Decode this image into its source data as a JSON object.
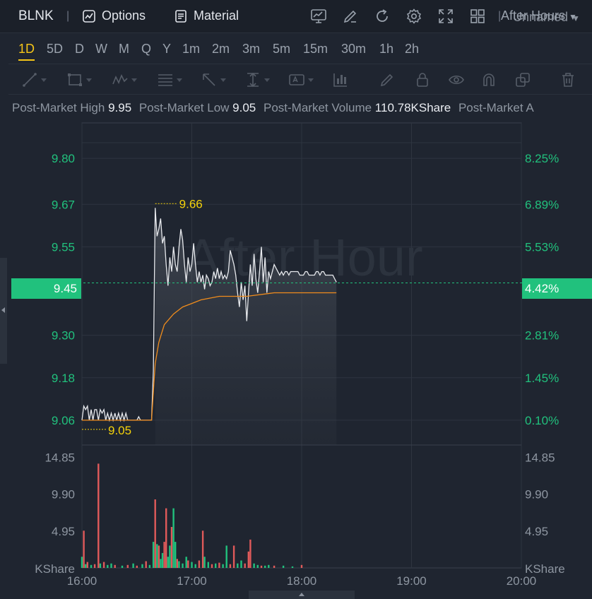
{
  "header": {
    "ticker": "BLNK",
    "separator": "|",
    "options_label": "Options",
    "material_label": "Material",
    "layout_separator": "|",
    "layout_name": "Unnamed"
  },
  "timeframes": [
    "1D",
    "5D",
    "D",
    "W",
    "M",
    "Q",
    "Y",
    "1m",
    "2m",
    "3m",
    "5m",
    "15m",
    "30m",
    "1h",
    "2h"
  ],
  "active_timeframe": "1D",
  "session_label": "After Hours",
  "stats": {
    "high_label": "Post-Market High",
    "high_value": "9.95",
    "low_label": "Post-Market Low",
    "low_value": "9.05",
    "volume_label": "Post-Market Volume",
    "volume_value": "110.78KShare",
    "truncated_label": "Post-Market A"
  },
  "colors": {
    "up": "#21c17d",
    "down": "#e05a5a",
    "price_line": "#e8eaee",
    "avg_line": "#f08c1c",
    "annotation": "#f5d20a",
    "background": "#1f2530"
  },
  "chart_data": [
    {
      "type": "line",
      "watermark": "After Hour",
      "x_ticks": [
        "16:00",
        "17:00",
        "18:00",
        "19:00",
        "20:00"
      ],
      "x_range": [
        "16:00",
        "20:00"
      ],
      "y_ticks": [
        "9.80",
        "9.67",
        "9.55",
        "9.30",
        "9.18",
        "9.06"
      ],
      "y_range": [
        8.99,
        9.9
      ],
      "y2_ticks": [
        "8.25%",
        "6.89%",
        "5.53%",
        "2.81%",
        "1.45%",
        "0.10%"
      ],
      "current_price": "9.45",
      "current_change": "4.42%",
      "annotations": [
        {
          "label": "9.66",
          "x": "16:40",
          "y": 9.66
        },
        {
          "label": "9.05",
          "x": "16:00",
          "y": 9.05
        }
      ],
      "series": [
        {
          "points": [
            [
              "16:00",
              9.06
            ],
            [
              "16:01",
              9.1
            ],
            [
              "16:02",
              9.09
            ],
            [
              "16:03",
              9.1
            ],
            [
              "16:04",
              9.06
            ],
            [
              "16:05",
              9.09
            ],
            [
              "16:06",
              9.06
            ],
            [
              "16:07",
              9.09
            ],
            [
              "16:08",
              9.09
            ],
            [
              "16:09",
              9.06
            ],
            [
              "16:10",
              9.09
            ],
            [
              "16:11",
              9.08
            ],
            [
              "16:12",
              9.09
            ],
            [
              "16:13",
              9.06
            ],
            [
              "16:14",
              9.08
            ],
            [
              "16:15",
              9.06
            ],
            [
              "16:16",
              9.08
            ],
            [
              "16:17",
              9.06
            ],
            [
              "16:18",
              9.08
            ],
            [
              "16:19",
              9.06
            ],
            [
              "16:20",
              9.08
            ],
            [
              "16:21",
              9.06
            ],
            [
              "16:22",
              9.08
            ],
            [
              "16:23",
              9.06
            ],
            [
              "16:24",
              9.08
            ],
            [
              "16:25",
              9.06
            ],
            [
              "16:26",
              9.06
            ],
            [
              "16:27",
              9.06
            ],
            [
              "16:28",
              9.06
            ],
            [
              "16:29",
              9.06
            ],
            [
              "16:30",
              9.06
            ],
            [
              "16:31",
              9.07
            ],
            [
              "16:32",
              9.06
            ],
            [
              "16:33",
              9.06
            ],
            [
              "16:34",
              9.06
            ],
            [
              "16:35",
              9.06
            ],
            [
              "16:36",
              9.06
            ],
            [
              "16:37",
              9.06
            ],
            [
              "16:38",
              9.06
            ],
            [
              "16:39",
              9.2
            ],
            [
              "16:40",
              9.66
            ],
            [
              "16:41",
              9.58
            ],
            [
              "16:42",
              9.6
            ],
            [
              "16:43",
              9.63
            ],
            [
              "16:44",
              9.56
            ],
            [
              "16:45",
              9.58
            ],
            [
              "16:46",
              9.5
            ],
            [
              "16:47",
              9.44
            ],
            [
              "16:48",
              9.52
            ],
            [
              "16:49",
              9.48
            ],
            [
              "16:50",
              9.55
            ],
            [
              "16:51",
              9.5
            ],
            [
              "16:52",
              9.48
            ],
            [
              "16:53",
              9.55
            ],
            [
              "16:54",
              9.6
            ],
            [
              "16:55",
              9.57
            ],
            [
              "16:56",
              9.5
            ],
            [
              "16:57",
              9.45
            ],
            [
              "16:58",
              9.52
            ],
            [
              "16:59",
              9.48
            ],
            [
              "17:00",
              9.5
            ],
            [
              "17:01",
              9.56
            ],
            [
              "17:02",
              9.5
            ],
            [
              "17:03",
              9.45
            ],
            [
              "17:04",
              9.48
            ],
            [
              "17:05",
              9.45
            ],
            [
              "17:06",
              9.47
            ],
            [
              "17:07",
              9.43
            ],
            [
              "17:08",
              9.47
            ],
            [
              "17:09",
              9.46
            ],
            [
              "17:10",
              9.44
            ],
            [
              "17:11",
              9.45
            ],
            [
              "17:12",
              9.48
            ],
            [
              "17:13",
              9.46
            ],
            [
              "17:14",
              9.49
            ],
            [
              "17:15",
              9.46
            ],
            [
              "17:16",
              9.48
            ],
            [
              "17:17",
              9.46
            ],
            [
              "17:18",
              9.47
            ],
            [
              "17:19",
              9.46
            ],
            [
              "17:20",
              9.48
            ],
            [
              "17:21",
              9.54
            ],
            [
              "17:22",
              9.52
            ],
            [
              "17:23",
              9.5
            ],
            [
              "17:24",
              9.47
            ],
            [
              "17:25",
              9.42
            ],
            [
              "17:26",
              9.38
            ],
            [
              "17:27",
              9.45
            ],
            [
              "17:28",
              9.4
            ],
            [
              "17:29",
              9.44
            ],
            [
              "17:30",
              9.34
            ],
            [
              "17:31",
              9.42
            ],
            [
              "17:32",
              9.5
            ],
            [
              "17:33",
              9.44
            ],
            [
              "17:34",
              9.53
            ],
            [
              "17:35",
              9.46
            ],
            [
              "17:36",
              9.42
            ],
            [
              "17:37",
              9.48
            ],
            [
              "17:38",
              9.55
            ],
            [
              "17:39",
              9.45
            ],
            [
              "17:40",
              9.52
            ],
            [
              "17:41",
              9.42
            ],
            [
              "17:42",
              9.48
            ],
            [
              "17:43",
              9.46
            ],
            [
              "17:44",
              9.48
            ],
            [
              "17:45",
              9.5
            ],
            [
              "17:46",
              9.49
            ],
            [
              "17:47",
              9.48
            ],
            [
              "17:48",
              9.47
            ],
            [
              "17:49",
              9.48
            ],
            [
              "17:50",
              9.47
            ],
            [
              "17:51",
              9.48
            ],
            [
              "17:52",
              9.48
            ],
            [
              "17:53",
              9.47
            ],
            [
              "17:54",
              9.48
            ],
            [
              "17:55",
              9.48
            ],
            [
              "17:56",
              9.48
            ],
            [
              "17:57",
              9.48
            ],
            [
              "17:58",
              9.48
            ],
            [
              "17:59",
              9.47
            ],
            [
              "18:00",
              9.47
            ],
            [
              "18:01",
              9.47
            ],
            [
              "18:02",
              9.48
            ],
            [
              "18:03",
              9.48
            ],
            [
              "18:04",
              9.47
            ],
            [
              "18:05",
              9.47
            ],
            [
              "18:06",
              9.47
            ],
            [
              "18:07",
              9.47
            ],
            [
              "18:08",
              9.48
            ],
            [
              "18:09",
              9.48
            ],
            [
              "18:10",
              9.47
            ],
            [
              "18:11",
              9.48
            ],
            [
              "18:12",
              9.48
            ],
            [
              "18:13",
              9.47
            ],
            [
              "18:14",
              9.47
            ],
            [
              "18:15",
              9.47
            ],
            [
              "18:16",
              9.47
            ],
            [
              "18:17",
              9.47
            ],
            [
              "18:18",
              9.46
            ],
            [
              "18:19",
              9.45
            ]
          ]
        },
        {
          "points": [
            [
              "16:00",
              9.06
            ],
            [
              "16:20",
              9.06
            ],
            [
              "16:38",
              9.06
            ],
            [
              "16:40",
              9.22
            ],
            [
              "16:42",
              9.28
            ],
            [
              "16:45",
              9.33
            ],
            [
              "16:50",
              9.36
            ],
            [
              "16:55",
              9.38
            ],
            [
              "17:00",
              9.39
            ],
            [
              "17:05",
              9.4
            ],
            [
              "17:15",
              9.41
            ],
            [
              "17:30",
              9.41
            ],
            [
              "17:45",
              9.42
            ],
            [
              "18:00",
              9.42
            ],
            [
              "18:19",
              9.42
            ]
          ]
        }
      ]
    },
    {
      "type": "bar",
      "ylabel": "KShare",
      "y_ticks": [
        "14.85",
        "9.90",
        "4.95"
      ],
      "y_range": [
        0,
        16.5
      ],
      "bars": [
        {
          "x": "16:00",
          "v": 1.5,
          "d": "up"
        },
        {
          "x": "16:01",
          "v": 5.0,
          "d": "down"
        },
        {
          "x": "16:02",
          "v": 0.5,
          "d": "up"
        },
        {
          "x": "16:03",
          "v": 0.8,
          "d": "down"
        },
        {
          "x": "16:05",
          "v": 0.4,
          "d": "up"
        },
        {
          "x": "16:07",
          "v": 0.5,
          "d": "down"
        },
        {
          "x": "16:09",
          "v": 14.0,
          "d": "down"
        },
        {
          "x": "16:10",
          "v": 0.6,
          "d": "up"
        },
        {
          "x": "16:12",
          "v": 0.8,
          "d": "down"
        },
        {
          "x": "16:14",
          "v": 0.4,
          "d": "up"
        },
        {
          "x": "16:16",
          "v": 0.6,
          "d": "up"
        },
        {
          "x": "16:18",
          "v": 0.4,
          "d": "down"
        },
        {
          "x": "16:22",
          "v": 0.3,
          "d": "up"
        },
        {
          "x": "16:25",
          "v": 0.4,
          "d": "down"
        },
        {
          "x": "16:28",
          "v": 0.6,
          "d": "up"
        },
        {
          "x": "16:30",
          "v": 0.3,
          "d": "down"
        },
        {
          "x": "16:33",
          "v": 0.5,
          "d": "up"
        },
        {
          "x": "16:35",
          "v": 0.9,
          "d": "down"
        },
        {
          "x": "16:37",
          "v": 0.4,
          "d": "up"
        },
        {
          "x": "16:39",
          "v": 3.5,
          "d": "up"
        },
        {
          "x": "16:40",
          "v": 9.2,
          "d": "down"
        },
        {
          "x": "16:41",
          "v": 3.2,
          "d": "up"
        },
        {
          "x": "16:42",
          "v": 3.0,
          "d": "down"
        },
        {
          "x": "16:43",
          "v": 1.2,
          "d": "up"
        },
        {
          "x": "16:44",
          "v": 2.0,
          "d": "up"
        },
        {
          "x": "16:45",
          "v": 3.5,
          "d": "down"
        },
        {
          "x": "16:46",
          "v": 8.0,
          "d": "down"
        },
        {
          "x": "16:47",
          "v": 1.5,
          "d": "up"
        },
        {
          "x": "16:48",
          "v": 3.0,
          "d": "up"
        },
        {
          "x": "16:49",
          "v": 5.5,
          "d": "down"
        },
        {
          "x": "16:50",
          "v": 8.0,
          "d": "up"
        },
        {
          "x": "16:51",
          "v": 3.5,
          "d": "up"
        },
        {
          "x": "16:52",
          "v": 1.2,
          "d": "down"
        },
        {
          "x": "16:53",
          "v": 0.9,
          "d": "up"
        },
        {
          "x": "16:55",
          "v": 0.6,
          "d": "up"
        },
        {
          "x": "16:57",
          "v": 1.5,
          "d": "up"
        },
        {
          "x": "16:58",
          "v": 1.0,
          "d": "down"
        },
        {
          "x": "17:00",
          "v": 0.8,
          "d": "up"
        },
        {
          "x": "17:02",
          "v": 0.5,
          "d": "up"
        },
        {
          "x": "17:04",
          "v": 1.0,
          "d": "down"
        },
        {
          "x": "17:06",
          "v": 5.0,
          "d": "down"
        },
        {
          "x": "17:07",
          "v": 1.5,
          "d": "up"
        },
        {
          "x": "17:09",
          "v": 0.8,
          "d": "up"
        },
        {
          "x": "17:11",
          "v": 0.5,
          "d": "down"
        },
        {
          "x": "17:13",
          "v": 0.6,
          "d": "up"
        },
        {
          "x": "17:15",
          "v": 0.7,
          "d": "down"
        },
        {
          "x": "17:17",
          "v": 0.5,
          "d": "up"
        },
        {
          "x": "17:19",
          "v": 3.0,
          "d": "up"
        },
        {
          "x": "17:21",
          "v": 0.5,
          "d": "down"
        },
        {
          "x": "17:23",
          "v": 3.0,
          "d": "down"
        },
        {
          "x": "17:25",
          "v": 0.6,
          "d": "up"
        },
        {
          "x": "17:27",
          "v": 1.0,
          "d": "up"
        },
        {
          "x": "17:29",
          "v": 0.6,
          "d": "down"
        },
        {
          "x": "17:31",
          "v": 2.2,
          "d": "down"
        },
        {
          "x": "17:32",
          "v": 3.8,
          "d": "down"
        },
        {
          "x": "17:34",
          "v": 0.6,
          "d": "up"
        },
        {
          "x": "17:36",
          "v": 0.4,
          "d": "up"
        },
        {
          "x": "17:38",
          "v": 0.3,
          "d": "down"
        },
        {
          "x": "17:40",
          "v": 0.3,
          "d": "up"
        },
        {
          "x": "17:42",
          "v": 0.4,
          "d": "up"
        },
        {
          "x": "17:45",
          "v": 0.3,
          "d": "down"
        },
        {
          "x": "17:50",
          "v": 0.3,
          "d": "up"
        },
        {
          "x": "17:55",
          "v": 0.2,
          "d": "up"
        },
        {
          "x": "18:00",
          "v": 0.4,
          "d": "down"
        }
      ]
    }
  ]
}
